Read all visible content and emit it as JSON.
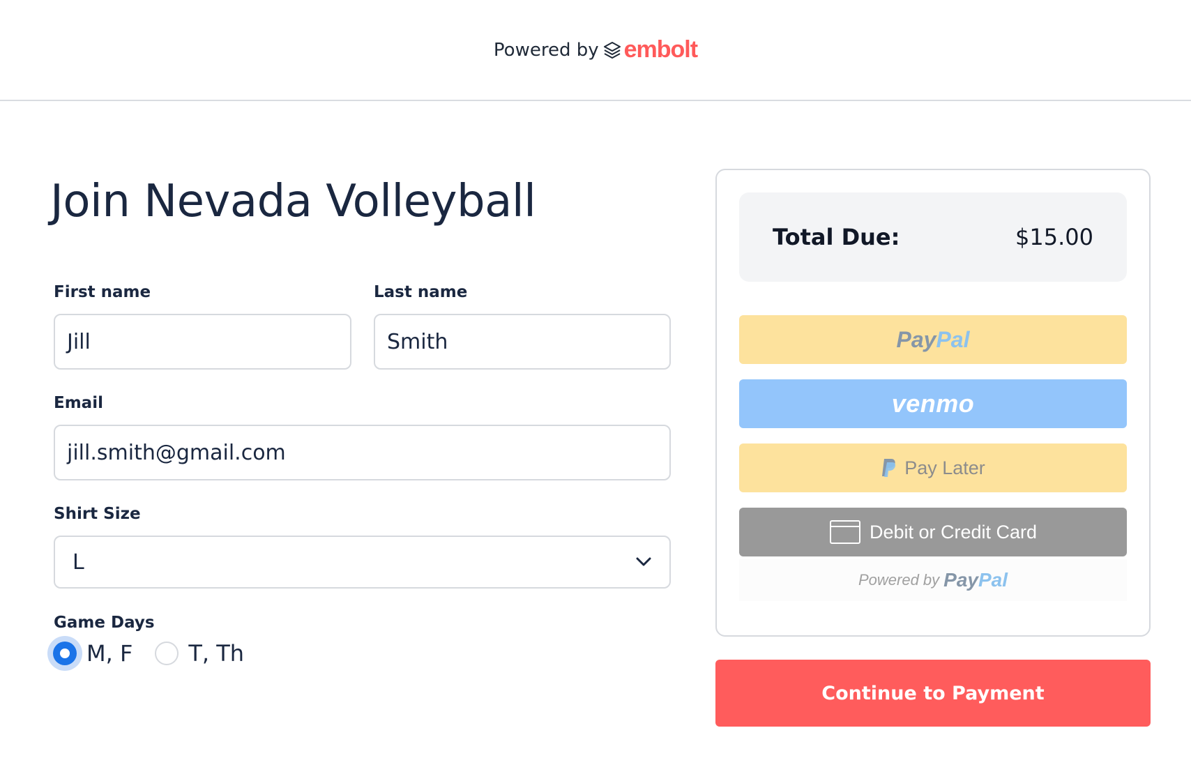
{
  "header": {
    "powered_by": "Powered by",
    "brand": "embolt"
  },
  "form": {
    "title": "Join Nevada Volleyball",
    "first_name": {
      "label": "First name",
      "value": "Jill"
    },
    "last_name": {
      "label": "Last name",
      "value": "Smith"
    },
    "email": {
      "label": "Email",
      "value": "jill.smith@gmail.com"
    },
    "shirt_size": {
      "label": "Shirt Size",
      "value": "L"
    },
    "game_days": {
      "label": "Game Days",
      "options": [
        {
          "label": "M, F",
          "checked": true
        },
        {
          "label": "T, Th",
          "checked": false
        }
      ]
    }
  },
  "summary": {
    "total_label": "Total Due:",
    "total_value": "$15.00",
    "buttons": {
      "paypal_a": "Pay",
      "paypal_b": "Pal",
      "venmo": "venmo",
      "pay_later": "Pay Later",
      "card": "Debit or Credit Card"
    },
    "powered_by": "Powered by",
    "powered_paypal_a": "Pay",
    "powered_paypal_b": "Pal"
  },
  "continue_label": "Continue to Payment",
  "colors": {
    "brand": "#ff5a5a",
    "primary_button": "#ff5c5c",
    "radio_selected": "#1a73e8",
    "paypal_yellow": "#fde29d",
    "venmo_blue": "#93c5fb",
    "card_gray": "#999999"
  }
}
